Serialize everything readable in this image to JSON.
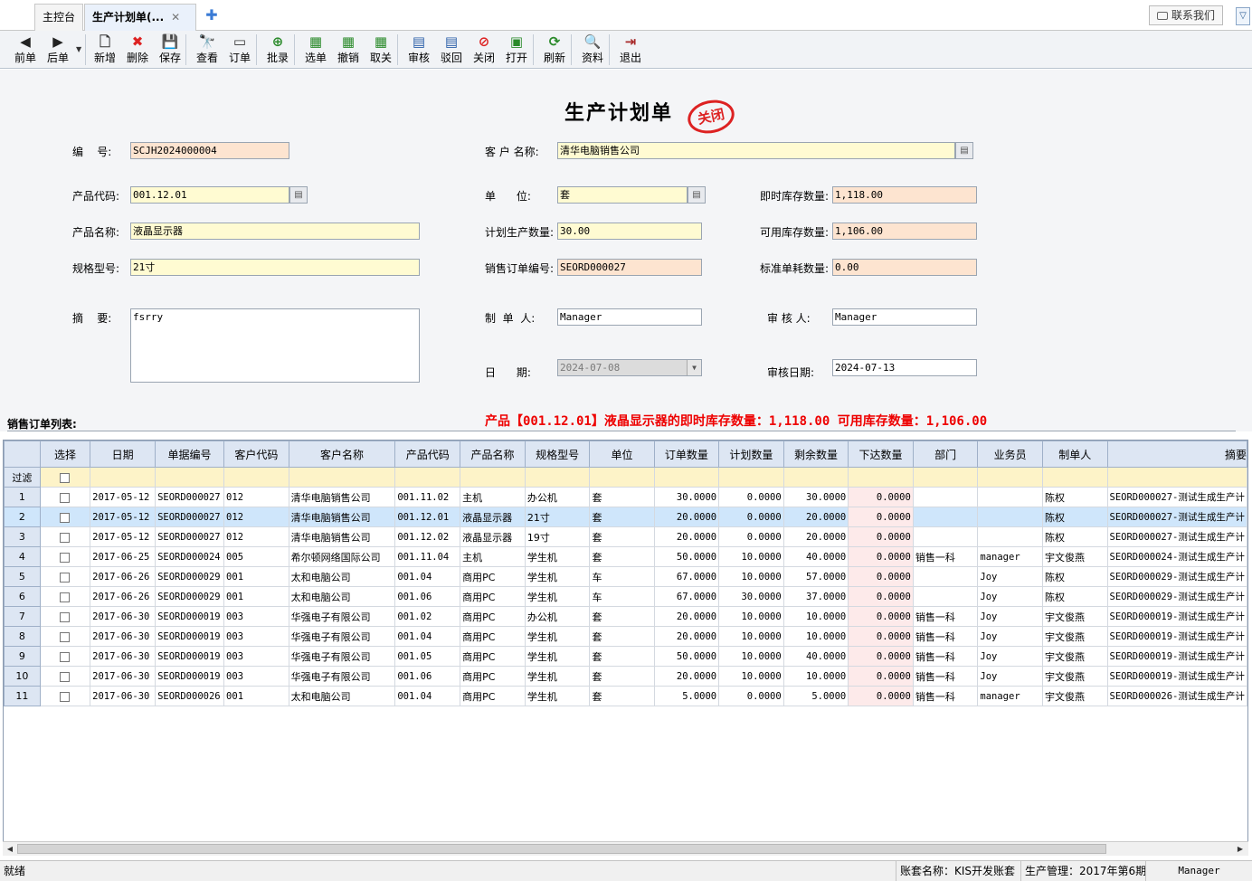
{
  "tabs": [
    {
      "label": "主控台"
    },
    {
      "label": "生产计划单(...",
      "close": "✕"
    }
  ],
  "contact_label": "联系我们",
  "toolbar": [
    {
      "label": "前单",
      "icon": "◀"
    },
    {
      "label": "后单",
      "icon": "▶"
    },
    {
      "label": "新增",
      "icon": "🗋"
    },
    {
      "label": "删除",
      "icon": "✖"
    },
    {
      "label": "保存",
      "icon": "💾"
    },
    {
      "label": "查看",
      "icon": "🔭"
    },
    {
      "label": "订单",
      "icon": "▭"
    },
    {
      "label": "批录",
      "icon": "⊕"
    },
    {
      "label": "选单",
      "icon": "▦"
    },
    {
      "label": "撤销",
      "icon": "▦"
    },
    {
      "label": "取关",
      "icon": "▦"
    },
    {
      "label": "审核",
      "icon": "▤"
    },
    {
      "label": "驳回",
      "icon": "▤"
    },
    {
      "label": "关闭",
      "icon": "⊘"
    },
    {
      "label": "打开",
      "icon": "▣"
    },
    {
      "label": "刷新",
      "icon": "⟳"
    },
    {
      "label": "资料",
      "icon": "🔍"
    },
    {
      "label": "退出",
      "icon": "⇥"
    }
  ],
  "form": {
    "title": "生产计划单",
    "stamp": "关闭",
    "code_label": "编    号:",
    "code": "SCJH2024000004",
    "customer_label": "客 户 名称:",
    "customer": "清华电脑销售公司",
    "product_code_label": "产品代码:",
    "product_code": "001.12.01",
    "unit_label": "单      位:",
    "unit": "套",
    "stock_now_label": "即时库存数量:",
    "stock_now": "1,118.00",
    "product_name_label": "产品名称:",
    "product_name": "液晶显示器",
    "plan_qty_label": "计划生产数量:",
    "plan_qty": "30.00",
    "stock_avail_label": "可用库存数量:",
    "stock_avail": "1,106.00",
    "spec_label": "规格型号:",
    "spec": "21寸",
    "sales_order_label": "销售订单编号:",
    "sales_order": "SEORD000027",
    "std_consume_label": "标准单耗数量:",
    "std_consume": "0.00",
    "memo_label": "摘    要:",
    "memo": "fsrry",
    "maker_label": "制  单  人:",
    "maker": "Manager",
    "auditor_label": "审 核 人:",
    "auditor": "Manager",
    "date_label": "日      期:",
    "date": "2024-07-08",
    "audit_date_label": "审核日期:",
    "audit_date": "2024-07-13"
  },
  "list_title": "销售订单列表:",
  "notice": "产品【001.12.01】液晶显示器的即时库存数量：1,118.00 可用库存数量：1,106.00",
  "grid": {
    "headers": [
      "选择",
      "日期",
      "单据编号",
      "客户代码",
      "客户名称",
      "产品代码",
      "产品名称",
      "规格型号",
      "单位",
      "订单数量",
      "计划数量",
      "剩余数量",
      "下达数量",
      "部门",
      "业务员",
      "制单人",
      "摘要"
    ],
    "filter_label": "过滤",
    "rows": [
      [
        "1",
        "2017-05-12",
        "SEORD000027",
        "012",
        "清华电脑销售公司",
        "001.11.02",
        "主机",
        "办公机",
        "套",
        "30.0000",
        "0.0000",
        "30.0000",
        "0.0000",
        "",
        "",
        "陈权",
        "SEORD000027-测试生成生产计"
      ],
      [
        "2",
        "2017-05-12",
        "SEORD000027",
        "012",
        "清华电脑销售公司",
        "001.12.01",
        "液晶显示器",
        "21寸",
        "套",
        "20.0000",
        "0.0000",
        "20.0000",
        "0.0000",
        "",
        "",
        "陈权",
        "SEORD000027-测试生成生产计"
      ],
      [
        "3",
        "2017-05-12",
        "SEORD000027",
        "012",
        "清华电脑销售公司",
        "001.12.02",
        "液晶显示器",
        "19寸",
        "套",
        "20.0000",
        "0.0000",
        "20.0000",
        "0.0000",
        "",
        "",
        "陈权",
        "SEORD000027-测试生成生产计"
      ],
      [
        "4",
        "2017-06-25",
        "SEORD000024",
        "005",
        "希尔顿网络国际公司",
        "001.11.04",
        "主机",
        "学生机",
        "套",
        "50.0000",
        "10.0000",
        "40.0000",
        "0.0000",
        "销售一科",
        "manager",
        "宇文俊燕",
        "SEORD000024-测试生成生产计"
      ],
      [
        "5",
        "2017-06-26",
        "SEORD000029",
        "001",
        "太和电脑公司",
        "001.04",
        "商用PC",
        "学生机",
        "车",
        "67.0000",
        "10.0000",
        "57.0000",
        "0.0000",
        "",
        "Joy",
        "陈权",
        "SEORD000029-测试生成生产计"
      ],
      [
        "6",
        "2017-06-26",
        "SEORD000029",
        "001",
        "太和电脑公司",
        "001.06",
        "商用PC",
        "学生机",
        "车",
        "67.0000",
        "30.0000",
        "37.0000",
        "0.0000",
        "",
        "Joy",
        "陈权",
        "SEORD000029-测试生成生产计"
      ],
      [
        "7",
        "2017-06-30",
        "SEORD000019",
        "003",
        "华强电子有限公司",
        "001.02",
        "商用PC",
        "办公机",
        "套",
        "20.0000",
        "10.0000",
        "10.0000",
        "0.0000",
        "销售一科",
        "Joy",
        "宇文俊燕",
        "SEORD000019-测试生成生产计"
      ],
      [
        "8",
        "2017-06-30",
        "SEORD000019",
        "003",
        "华强电子有限公司",
        "001.04",
        "商用PC",
        "学生机",
        "套",
        "20.0000",
        "10.0000",
        "10.0000",
        "0.0000",
        "销售一科",
        "Joy",
        "宇文俊燕",
        "SEORD000019-测试生成生产计"
      ],
      [
        "9",
        "2017-06-30",
        "SEORD000019",
        "003",
        "华强电子有限公司",
        "001.05",
        "商用PC",
        "学生机",
        "套",
        "50.0000",
        "10.0000",
        "40.0000",
        "0.0000",
        "销售一科",
        "Joy",
        "宇文俊燕",
        "SEORD000019-测试生成生产计"
      ],
      [
        "10",
        "2017-06-30",
        "SEORD000019",
        "003",
        "华强电子有限公司",
        "001.06",
        "商用PC",
        "学生机",
        "套",
        "20.0000",
        "10.0000",
        "10.0000",
        "0.0000",
        "销售一科",
        "Joy",
        "宇文俊燕",
        "SEORD000019-测试生成生产计"
      ],
      [
        "11",
        "2017-06-30",
        "SEORD000026",
        "001",
        "太和电脑公司",
        "001.04",
        "商用PC",
        "学生机",
        "套",
        "5.0000",
        "0.0000",
        "5.0000",
        "0.0000",
        "销售一科",
        "manager",
        "宇文俊燕",
        "SEORD000026-测试生成生产计"
      ]
    ]
  },
  "status": {
    "ready": "就绪",
    "account": "账套名称：KIS开发账套",
    "period": "生产管理：2017年第6期",
    "user": "Manager"
  }
}
